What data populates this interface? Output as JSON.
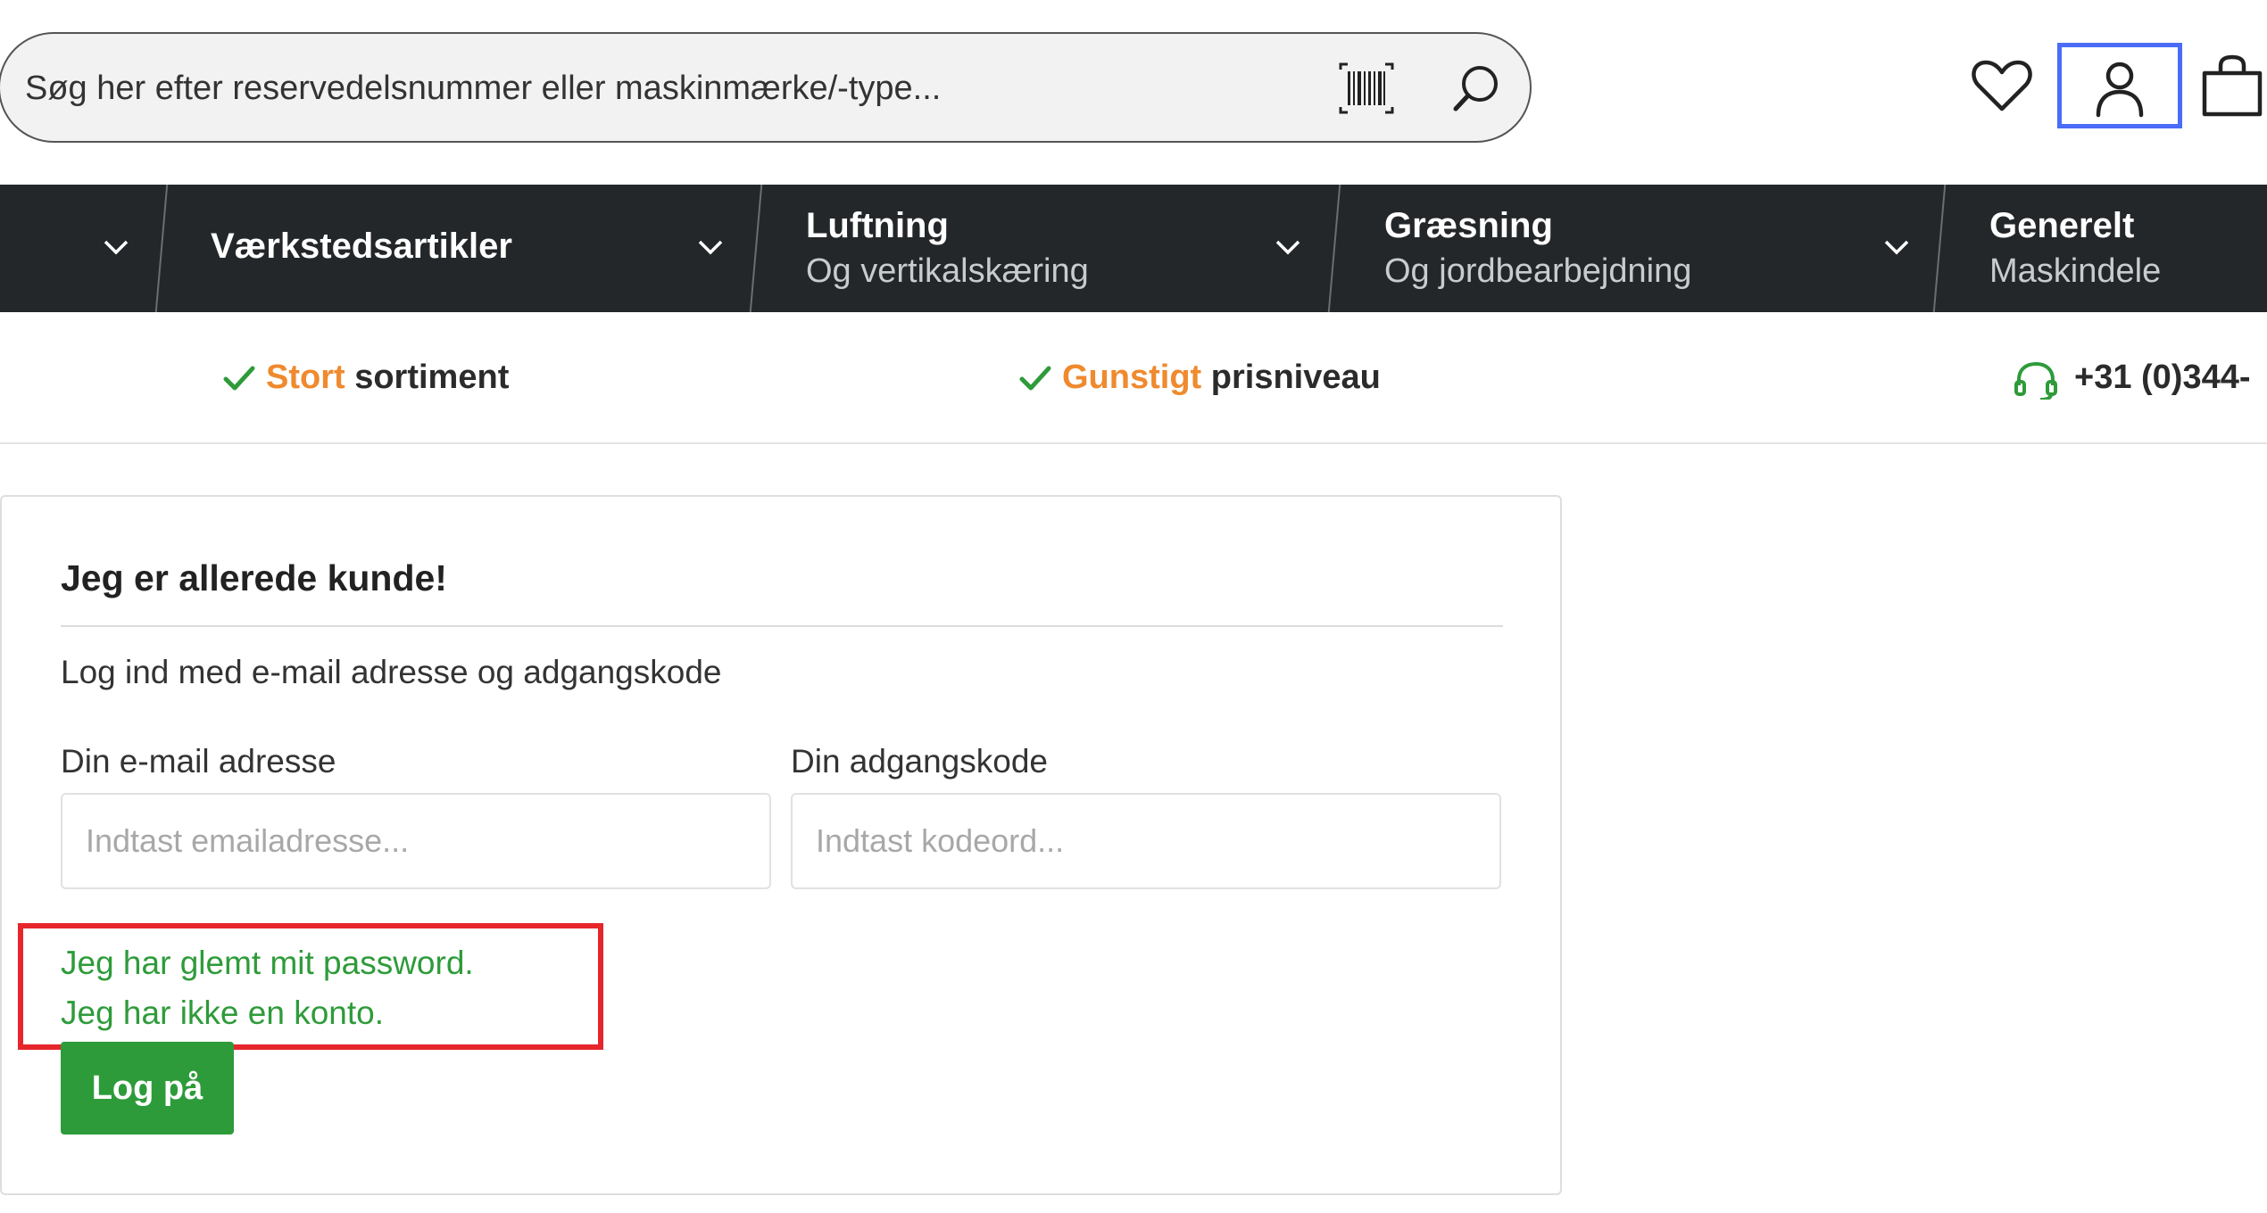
{
  "header": {
    "search": {
      "placeholder": "Søg her efter reservedelsnummer eller maskinmærke/-type..."
    },
    "icons": {
      "barcode": "barcode-icon",
      "search": "search-icon",
      "wishlist": "heart-icon",
      "account": "user-icon",
      "cart": "shopping-bag-icon"
    }
  },
  "nav": {
    "items": [
      {
        "title": "Værkstedsartikler",
        "subtitle": ""
      },
      {
        "title": "Luftning",
        "subtitle": "Og vertikalskæring"
      },
      {
        "title": "Græsning",
        "subtitle": "Og jordbearbejdning"
      },
      {
        "title": "Generelt",
        "subtitle": "Maskindele"
      }
    ]
  },
  "usp": {
    "items": [
      {
        "accent": "Stort",
        "text": " sortiment"
      },
      {
        "accent": "Gunstigt",
        "text": " prisniveau"
      }
    ],
    "phone": "+31 (0)344-"
  },
  "login": {
    "title": "Jeg er allerede kunde!",
    "description": "Log ind med e-mail adresse og adgangskode",
    "email_label": "Din e-mail adresse",
    "email_placeholder": "Indtast emailadresse...",
    "password_label": "Din adgangskode",
    "password_placeholder": "Indtast kodeord...",
    "forgot_password": "Jeg har glemt mit password.",
    "no_account": "Jeg har ikke en konto.",
    "submit": "Log på"
  },
  "colors": {
    "nav_bg": "#242729",
    "accent_orange": "#ef8a2e",
    "brand_green": "#2e9b3a",
    "highlight_blue": "#4a6cf7",
    "highlight_red": "#e6262b"
  }
}
